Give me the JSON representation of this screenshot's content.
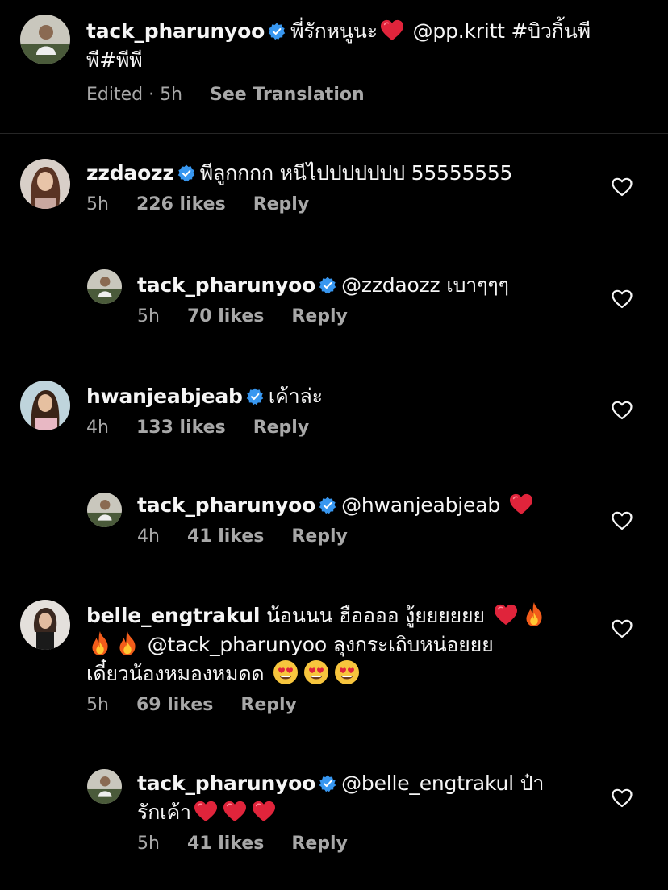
{
  "caption": {
    "username": "tack_pharunyoo",
    "text_before_heart": "พี่รักหนูนะ",
    "text_after_heart": "@pp.kritt #บิวกิ้นพี",
    "text_line2": "พี#พีพี",
    "edited_time": "Edited · 5h",
    "see_translation": "See Translation"
  },
  "comments": [
    {
      "username": "zzdaozz",
      "text": "พีลูกกกก หนีไปปปปปปป 55555555",
      "time": "5h",
      "likes": "226 likes",
      "reply": "Reply"
    },
    {
      "username": "tack_pharunyoo",
      "text": "@zzdaozz เบาๆๆๆ",
      "time": "5h",
      "likes": "70 likes",
      "reply": "Reply"
    },
    {
      "username": "hwanjeabjeab",
      "text": "เค้าล่ะ",
      "time": "4h",
      "likes": "133 likes",
      "reply": "Reply"
    },
    {
      "username": "tack_pharunyoo",
      "text": "@hwanjeabjeab",
      "time": "4h",
      "likes": "41 likes",
      "reply": "Reply"
    },
    {
      "username": "belle_engtrakul",
      "text_line1": "น้อนนน ฮืออออ งู้ยยยยยย",
      "text_line2": "@tack_pharunyoo ลุงกระเถิบหน่อยยย",
      "text_line3": "เดี๋ยวน้องหมองหมดด",
      "time": "5h",
      "likes": "69 likes",
      "reply": "Reply"
    },
    {
      "username": "tack_pharunyoo",
      "text_line1": "@belle_engtrakul ป๋า",
      "text_line2": "รักเค้า",
      "time": "5h",
      "likes": "41 likes",
      "reply": "Reply"
    }
  ],
  "icons": {
    "verified": "verified-badge-icon",
    "like": "heart-outline-icon"
  },
  "colors": {
    "background": "#000000",
    "verified": "#3897f0",
    "meta": "#a8a8a8",
    "emoji_heart": "#e0243b"
  }
}
